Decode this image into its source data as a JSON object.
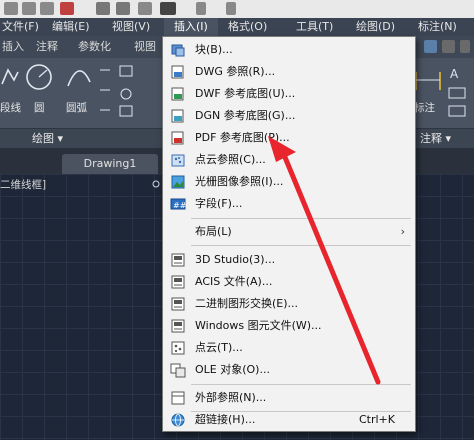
{
  "menubar": {
    "items": [
      {
        "label": "文件(F)"
      },
      {
        "label": "编辑(E)"
      },
      {
        "label": "视图(V)"
      },
      {
        "label": "插入(I)"
      },
      {
        "label": "格式(O)"
      },
      {
        "label": "工具(T)"
      },
      {
        "label": "绘图(D)"
      },
      {
        "label": "标注(N)"
      }
    ]
  },
  "ribbon_tabs": {
    "items": [
      {
        "label": "插入"
      },
      {
        "label": "注释"
      },
      {
        "label": "参数化"
      },
      {
        "label": "视图"
      }
    ]
  },
  "ribbon": {
    "polyline_label": "段线",
    "circle_label": "圆",
    "arc_label": "圆弧",
    "dimension_label": "标注"
  },
  "panel_titles": {
    "draw": "绘图 ▾",
    "annotate": "注释 ▾"
  },
  "doc_tab": {
    "label": "Drawing1"
  },
  "viewport": {
    "label": "二维线框]"
  },
  "insert_menu": {
    "items": [
      {
        "label": "块(B)...",
        "icon": "block-icon"
      },
      {
        "label": "DWG 参照(R)...",
        "icon": "dwg-reference-icon"
      },
      {
        "label": "DWF 参考底图(U)...",
        "icon": "dwf-underlay-icon"
      },
      {
        "label": "DGN 参考底图(G)...",
        "icon": "dgn-underlay-icon"
      },
      {
        "label": "PDF 参考底图(P)...",
        "icon": "pdf-underlay-icon"
      },
      {
        "label": "点云参照(C)...",
        "icon": "point-cloud-icon"
      },
      {
        "label": "光栅图像参照(I)...",
        "icon": "raster-image-icon"
      },
      {
        "label": "字段(F)...",
        "icon": "field-icon"
      },
      {
        "label": "布局(L)",
        "icon": ""
      },
      {
        "label": "3D Studio(3)...",
        "icon": "3d-studio-icon"
      },
      {
        "label": "ACIS 文件(A)...",
        "icon": "acis-file-icon"
      },
      {
        "label": "二进制图形交换(E)...",
        "icon": "binary-exchange-icon"
      },
      {
        "label": "Windows 图元文件(W)...",
        "icon": "windows-metafile-icon"
      },
      {
        "label": "点云(T)...",
        "icon": "point-cloud-icon"
      },
      {
        "label": "OLE 对象(O)...",
        "icon": "ole-object-icon"
      },
      {
        "label": "外部参照(N)...",
        "icon": "external-reference-icon"
      },
      {
        "label": "超链接(H)...",
        "icon": "hyperlink-icon"
      }
    ],
    "layout_submenu_arrow": "›",
    "hyperlink_shortcut": "Ctrl+K"
  },
  "colors": {
    "menu_bg": "#f2f2f2",
    "ribbon_bg": "#4a5361",
    "canvas_bg": "#1e2738",
    "arrow": "#e8242c"
  }
}
